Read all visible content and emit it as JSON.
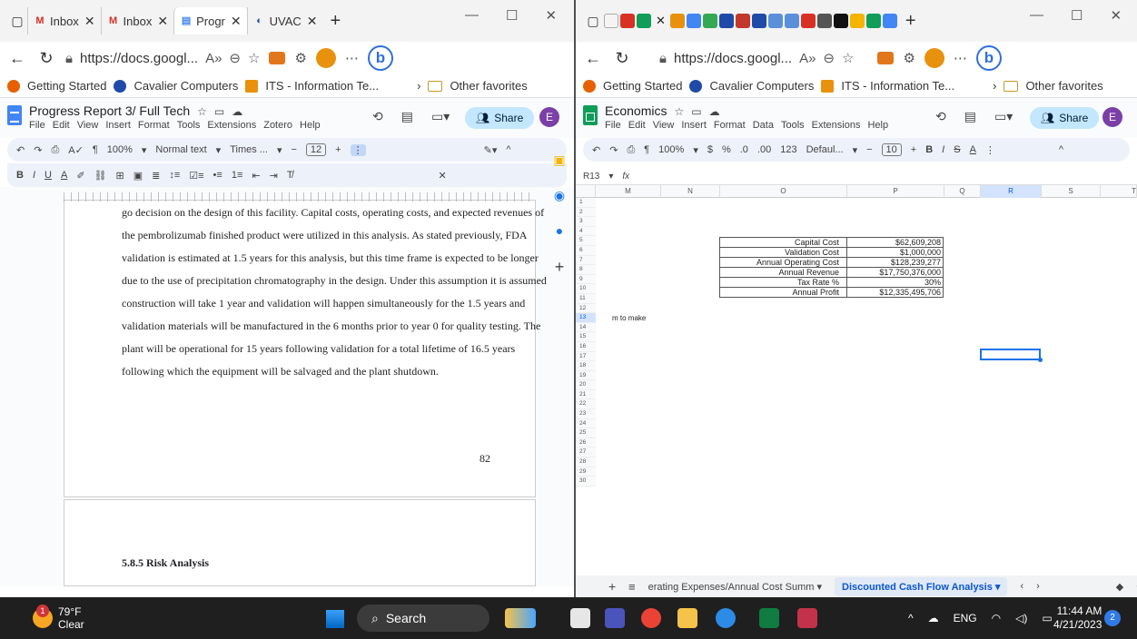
{
  "left_window": {
    "tabs": [
      {
        "title": "Inbox"
      },
      {
        "title": "Inbox"
      },
      {
        "title": "Progr"
      },
      {
        "title": "UVAC"
      }
    ],
    "url": "https://docs.googl...",
    "favorites": [
      "Getting Started",
      "Cavalier Computers",
      "ITS - Information Te..."
    ],
    "other_favorites": "Other favorites",
    "doc_title": "Progress Report 3/ Full Tech",
    "menus": [
      "File",
      "Edit",
      "View",
      "Insert",
      "Format",
      "Tools",
      "Extensions",
      "Zotero",
      "Help"
    ],
    "share_label": "Share",
    "avatar_letter": "E",
    "zoom": "100%",
    "style": "Normal text",
    "font": "Times ...",
    "font_size": "12",
    "paragraph_lines": [
      "go decision on the design of this facility. Capital costs, operating costs, and expected revenues of",
      "the pembrolizumab finished product were utilized in this analysis. As stated previously, FDA",
      "validation is estimated at 1.5 years for this analysis, but this time frame is expected to be longer",
      "due to the use of precipitation chromatography in the design. Under this assumption it is assumed",
      "construction will take 1 year and validation will happen simultaneously for the 1.5 years and",
      "validation materials will be manufactured in the 6 months prior to year 0 for quality testing. The",
      "plant will be operational for 15 years following validation for a total lifetime of 16.5 years",
      "following which the equipment will be salvaged and the plant shutdown."
    ],
    "page_number": "82",
    "section_heading": "5.8.5 Risk Analysis"
  },
  "right_window": {
    "url": "https://docs.googl...",
    "favorites": [
      "Getting Started",
      "Cavalier Computers",
      "ITS - Information Te..."
    ],
    "other_favorites": "Other favorites",
    "sheet_title": "Economics",
    "menus": [
      "File",
      "Edit",
      "View",
      "Insert",
      "Format",
      "Data",
      "Tools",
      "Extensions",
      "Help"
    ],
    "share_label": "Share",
    "avatar_letter": "E",
    "zoom": "100%",
    "currency": "$",
    "percent": "%",
    "dec_minus": ".0",
    "dec_plus": ".00",
    "num_format": "123",
    "font": "Defaul...",
    "font_size": "10",
    "cell_ref": "R13",
    "fx": "fx",
    "columns": [
      "M",
      "N",
      "O",
      "P",
      "Q",
      "R",
      "S",
      "T"
    ],
    "rows": [
      "1",
      "2",
      "3",
      "4",
      "5",
      "6",
      "7",
      "8",
      "9",
      "10",
      "11",
      "12",
      "13",
      "14",
      "15",
      "16",
      "17",
      "18",
      "19",
      "20",
      "21",
      "22",
      "23",
      "24",
      "25",
      "26",
      "27",
      "28",
      "29",
      "30"
    ],
    "table": [
      {
        "label": "Capital Cost",
        "value": "$62,609,208"
      },
      {
        "label": "Validation Cost",
        "value": "$1,000,000"
      },
      {
        "label": "Annual Operating Cost",
        "value": "$128,239,277"
      },
      {
        "label": "Annual Revenue",
        "value": "$17,750,376,000"
      },
      {
        "label": "Tax Rate %",
        "value": "30%"
      },
      {
        "label": "Annual Profit",
        "value": "$12,335,495,706"
      }
    ],
    "overflow_text": "m to make",
    "sheet_tabs": [
      "erating Expenses/Annual Cost Summ",
      "Discounted Cash Flow Analysis"
    ]
  },
  "taskbar": {
    "temperature": "79°F",
    "condition": "Clear",
    "weather_badge": "1",
    "search_label": "Search",
    "language": "ENG",
    "time": "11:44 AM",
    "date": "4/21/2023",
    "notifications": "2"
  }
}
